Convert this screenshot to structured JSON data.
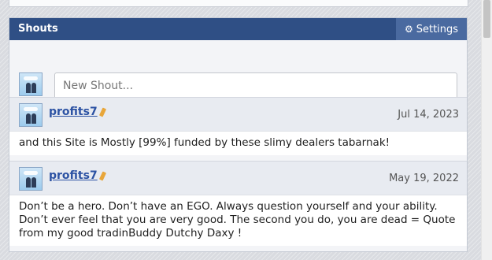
{
  "shoutbox": {
    "title": "Shouts",
    "settings_label": "Settings",
    "new_shout_placeholder": "New Shout...",
    "shouts": [
      {
        "username": "profits7",
        "date": "Jul 14, 2023",
        "message": "and this Site is Mostly [99%] funded by these slimy dealers tabarnak!"
      },
      {
        "username": "profits7",
        "date": "May 19, 2022",
        "message": "Don’t be a hero. Don’t have an EGO. Always question yourself and your ability. Don’t ever feel that you are very good. The second you do, you are dead = Quote from my good tradinBuddy Dutchy Daxy !"
      }
    ]
  },
  "icons": {
    "settings": "gear-icon",
    "edit": "pencil-icon",
    "avatar": "user-avatar"
  },
  "colors": {
    "header_bg": "#2f4f85",
    "settings_bg": "#4a6aa0",
    "username": "#2c52a3",
    "edit_icon": "#e8a63a"
  }
}
